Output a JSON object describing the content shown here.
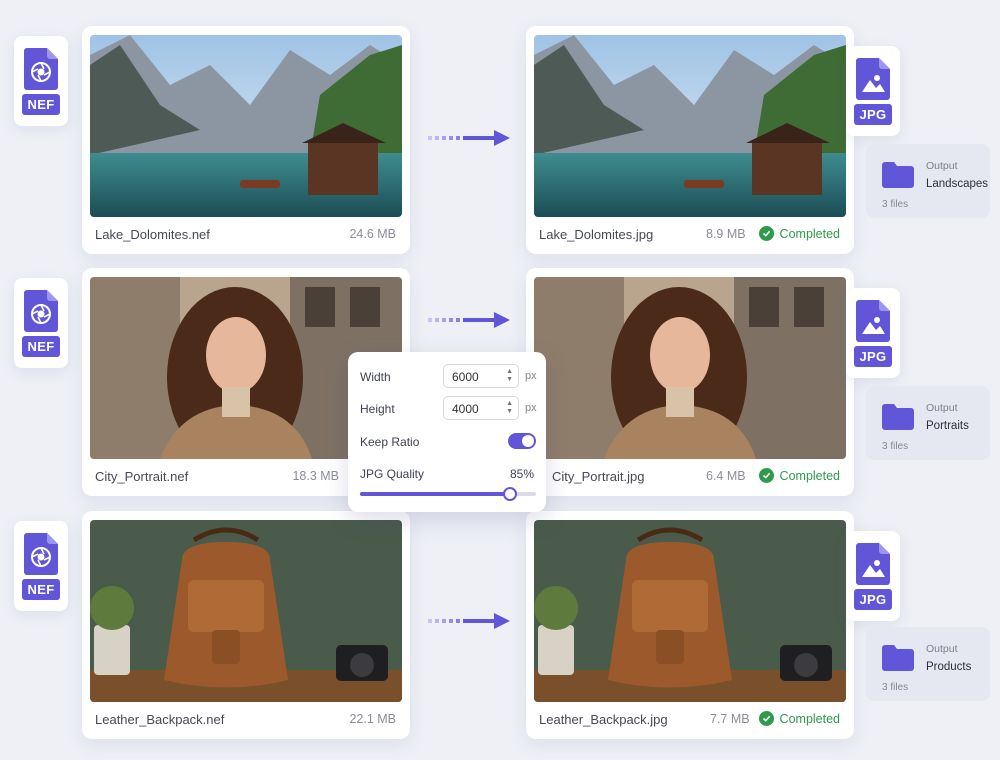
{
  "colors": {
    "accent": "#6156d8",
    "success": "#2e9a4c"
  },
  "icons": {
    "source_file": "aperture-file-icon",
    "output_file": "image-file-icon",
    "arrow": "dashed-arrow-right-icon",
    "folder": "folder-icon",
    "status": "check-circle-icon"
  },
  "jobs": [
    {
      "source": {
        "format": "NEF",
        "name": "Lake_Dolomites.nef",
        "size": "24.6 MB"
      },
      "output": {
        "format": "JPG",
        "name": "Lake_Dolomites.jpg",
        "size": "8.9 MB",
        "status": "Completed"
      },
      "folder": {
        "label": "Output",
        "name": "Landscapes",
        "count": "3 files"
      }
    },
    {
      "source": {
        "format": "NEF",
        "name": "City_Portrait.nef",
        "size": "18.3 MB"
      },
      "output": {
        "format": "JPG",
        "name": "City_Portrait.jpg",
        "size": "6.4 MB",
        "status": "Completed"
      },
      "folder": {
        "label": "Output",
        "name": "Portraits",
        "count": "3 files"
      }
    },
    {
      "source": {
        "format": "NEF",
        "name": "Leather_Backpack.nef",
        "size": "22.1 MB"
      },
      "output": {
        "format": "JPG",
        "name": "Leather_Backpack.jpg",
        "size": "7.7 MB",
        "status": "Completed"
      },
      "folder": {
        "label": "Output",
        "name": "Products",
        "count": "3 files"
      }
    }
  ],
  "settings": {
    "width_label": "Width",
    "width_value": "6000",
    "width_unit": "px",
    "height_label": "Height",
    "height_value": "4000",
    "height_unit": "px",
    "keep_ratio_label": "Keep Ratio",
    "keep_ratio_on": true,
    "quality_label": "JPG Quality",
    "quality_value": "85%",
    "quality_fraction": 0.85
  }
}
